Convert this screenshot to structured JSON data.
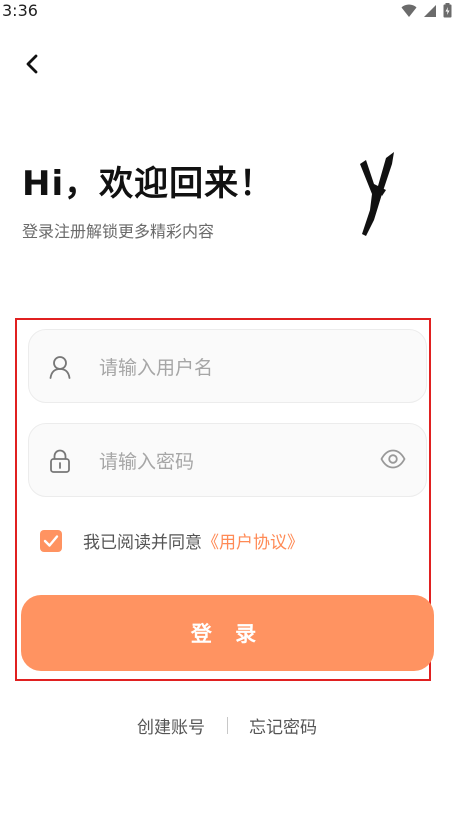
{
  "status_bar": {
    "time": "3:36",
    "icons": [
      "wifi-icon",
      "signal-icon",
      "battery-icon"
    ]
  },
  "header": {
    "back_icon": "chevron-left-icon",
    "title": "Hi，欢迎回来！",
    "subtitle": "登录注册解锁更多精彩内容",
    "brand_mark": "Y"
  },
  "form": {
    "username": {
      "icon": "user-icon",
      "value": "",
      "placeholder": "请输入用户名"
    },
    "password": {
      "icon": "lock-icon",
      "value": "",
      "placeholder": "请输入密码",
      "toggle_icon": "eye-icon"
    },
    "agreement": {
      "checked": true,
      "text": "我已阅读并同意",
      "link": "《用户协议》"
    },
    "login_label": "登 录"
  },
  "footer": {
    "create_account": "创建账号",
    "forgot_password": "忘记密码"
  },
  "colors": {
    "accent": "#ff9361",
    "link": "#ff8a55",
    "highlight_border": "#e02020"
  }
}
